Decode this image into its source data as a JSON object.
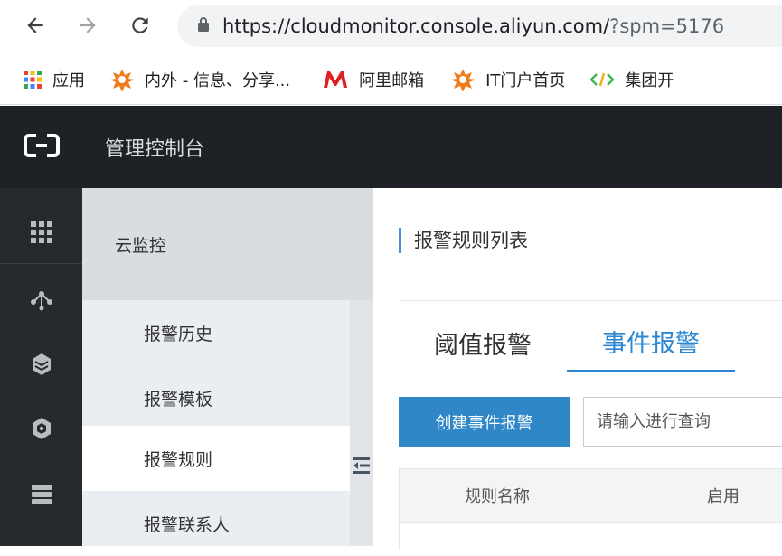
{
  "browser": {
    "url_main": "https://cloudmonitor.console.aliyun.com/",
    "url_rest": "?spm=5176",
    "bookmarks": [
      {
        "label": "应用",
        "icon": "apps-grid-icon"
      },
      {
        "label": "内外 - 信息、分享...",
        "icon": "neiwai-star-icon"
      },
      {
        "label": "阿里邮箱",
        "icon": "mail-m-icon"
      },
      {
        "label": "IT门户首页",
        "icon": "it-portal-star-icon"
      },
      {
        "label": "集团开",
        "icon": "code-brackets-icon"
      }
    ]
  },
  "header": {
    "title": "管理控制台"
  },
  "sidebar": {
    "section_title": "云监控",
    "items": [
      {
        "label": "报警历史",
        "active": false
      },
      {
        "label": "报警模板",
        "active": false
      },
      {
        "label": "报警规则",
        "active": true
      },
      {
        "label": "报警联系人",
        "active": false
      }
    ]
  },
  "main": {
    "page_title": "报警规则列表",
    "tabs": [
      {
        "label": "阈值报警",
        "active": false
      },
      {
        "label": "事件报警",
        "active": true
      }
    ],
    "create_button": "创建事件报警",
    "search_placeholder": "请输入进行查询",
    "table_headers": [
      "规则名称",
      "启用"
    ]
  },
  "colors": {
    "accent": "#2b87d1",
    "header_bg": "#1e2226",
    "rail_bg": "#26292d"
  }
}
